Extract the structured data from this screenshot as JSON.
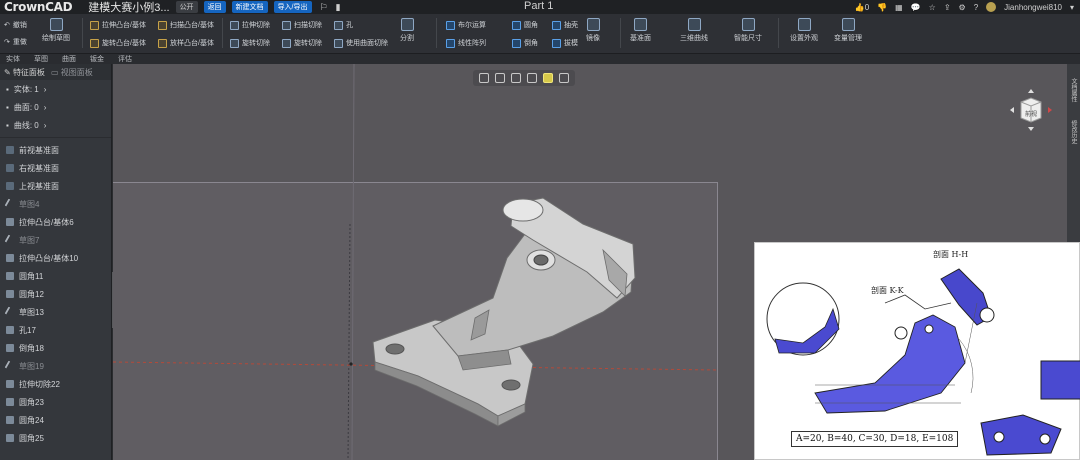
{
  "titlebar": {
    "logo": "CrownCAD",
    "doc_title": "建模大赛小例3...",
    "visibility": "公开",
    "btn_back": "返回",
    "btn_new": "新建文档",
    "btn_import": "导入/导出",
    "part_name": "Part 1",
    "likes": "0",
    "user": "Jianhongwei810"
  },
  "ribbon": {
    "undo": "撤销",
    "redo": "重做",
    "sketch": "绘制草图",
    "extrude_boss": "拉伸凸台/基体",
    "sweep_boss": "扫描凸台/基体",
    "revolve_boss": "旋转凸台/基体",
    "loft_boss": "放样凸台/基体",
    "extrude_cut": "拉伸切除",
    "sweep_cut": "扫描切除",
    "revolve_cut": "旋转切除",
    "surface_cut": "使用曲面切除",
    "hole": "孔",
    "split": "分割",
    "boolean": "布尔运算",
    "linear_pattern": "线性阵列",
    "fillet": "圆角",
    "shell": "抽壳",
    "chamfer": "倒角",
    "draft": "拔模",
    "mirror": "镜像",
    "ref_plane": "基准面",
    "curve_3d": "三维曲线",
    "smart_dim": "智能尺寸",
    "set_material": "设置外观",
    "var_manage": "变量管理"
  },
  "tabs": [
    "实体",
    "草图",
    "曲面",
    "钣金",
    "评估"
  ],
  "sidebar": {
    "tab_feature": "特征面板",
    "tab_view": "视图面板",
    "groups": [
      {
        "label": "实体: 1"
      },
      {
        "label": "曲面: 0"
      },
      {
        "label": "曲线: 0"
      }
    ],
    "items": [
      {
        "label": "前视基准面",
        "icon": "plane",
        "dim": false
      },
      {
        "label": "右视基准面",
        "icon": "plane",
        "dim": false
      },
      {
        "label": "上视基准面",
        "icon": "plane",
        "dim": false
      },
      {
        "label": "草图4",
        "icon": "sketch",
        "dim": true
      },
      {
        "label": "拉伸凸台/基体6",
        "icon": "feature",
        "dim": false
      },
      {
        "label": "草图7",
        "icon": "sketch",
        "dim": true
      },
      {
        "label": "拉伸凸台/基体10",
        "icon": "feature",
        "dim": false
      },
      {
        "label": "圆角11",
        "icon": "feature",
        "dim": false
      },
      {
        "label": "圆角12",
        "icon": "feature",
        "dim": false
      },
      {
        "label": "草图13",
        "icon": "sketch",
        "dim": false
      },
      {
        "label": "孔17",
        "icon": "feature",
        "dim": false
      },
      {
        "label": "倒角18",
        "icon": "feature",
        "dim": false
      },
      {
        "label": "草图19",
        "icon": "sketch",
        "dim": true
      },
      {
        "label": "拉伸切除22",
        "icon": "feature",
        "dim": false
      },
      {
        "label": "圆角23",
        "icon": "feature",
        "dim": false
      },
      {
        "label": "圆角24",
        "icon": "feature",
        "dim": false
      },
      {
        "label": "圆角25",
        "icon": "feature",
        "dim": false
      }
    ]
  },
  "right_panel": {
    "tab_props": "文档属性",
    "tab_hist": "修改历史"
  },
  "viewcube": {
    "face": "前视"
  },
  "overlay": {
    "section_hh": "剖面 H-H",
    "section_kk": "剖面 K-K",
    "params": "A=20, B=40, C=30, D=18, E=108"
  }
}
